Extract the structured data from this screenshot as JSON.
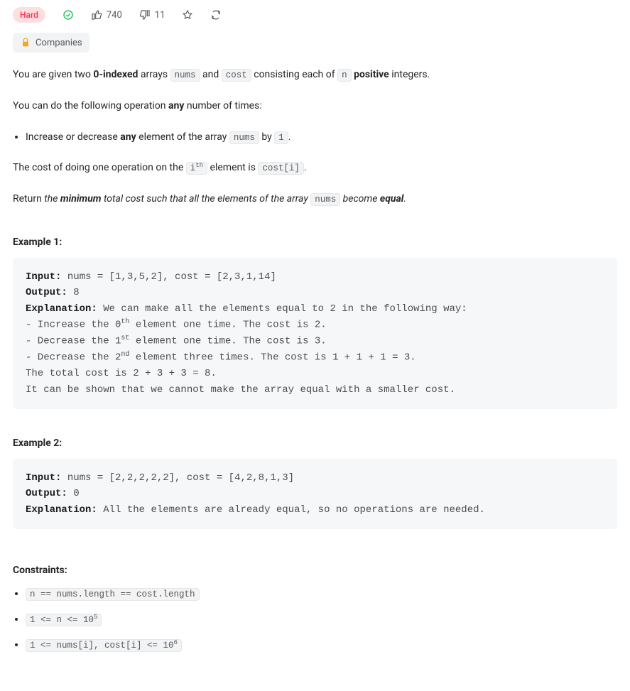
{
  "meta": {
    "difficulty": "Hard",
    "likes": "740",
    "dislikes": "11",
    "companies_label": "Companies"
  },
  "description": {
    "p1_a": "You are given two ",
    "p1_b": "0-indexed",
    "p1_c": " arrays ",
    "p1_code1": "nums",
    "p1_d": " and ",
    "p1_code2": "cost",
    "p1_e": " consisting each of ",
    "p1_code3": "n",
    "p1_f": " ",
    "p1_g": "positive",
    "p1_h": " integers.",
    "p2_a": "You can do the following operation ",
    "p2_b": "any",
    "p2_c": " number of times:",
    "li1_a": "Increase or decrease ",
    "li1_b": "any",
    "li1_c": " element of the array ",
    "li1_code1": "nums",
    "li1_d": " by ",
    "li1_code2": "1",
    "li1_e": ".",
    "p3_a": "The cost of doing one operation on the ",
    "p3_code1_base": "i",
    "p3_code1_sup": "th",
    "p3_b": " element is ",
    "p3_code2": "cost[i]",
    "p3_c": ".",
    "p4_a": "Return ",
    "p4_em1": "the ",
    "p4_strong1": "minimum",
    "p4_em2": " total cost such that all the elements of the array ",
    "p4_code1": "nums",
    "p4_em3": " become ",
    "p4_strong2": "equal",
    "p4_em4": "."
  },
  "examples": {
    "h1": "Example 1:",
    "ex1": {
      "k_in": "Input:",
      "in": " nums = [1,3,5,2], cost = [2,3,1,14]",
      "k_out": "Output:",
      "out": " 8",
      "k_exp": "Explanation:",
      "l1": " We can make all the elements equal to 2 in the following way:",
      "l2a": "- Increase the 0",
      "l2sup": "th",
      "l2b": " element one time. The cost is 2.",
      "l3a": "- Decrease the 1",
      "l3sup": "st",
      "l3b": " element one time. The cost is 3.",
      "l4a": "- Decrease the 2",
      "l4sup": "nd",
      "l4b": " element three times. The cost is 1 + 1 + 1 = 3.",
      "l5": "The total cost is 2 + 3 + 3 = 8.",
      "l6": "It can be shown that we cannot make the array equal with a smaller cost."
    },
    "h2": "Example 2:",
    "ex2": {
      "k_in": "Input:",
      "in": " nums = [2,2,2,2,2], cost = [4,2,8,1,3]",
      "k_out": "Output:",
      "out": " 0",
      "k_exp": "Explanation:",
      "l1": " All the elements are already equal, so no operations are needed."
    }
  },
  "constraints": {
    "heading": "Constraints:",
    "c1": "n == nums.length == cost.length",
    "c2_a": "1 <= n <= 10",
    "c2_sup": "5",
    "c3_a": "1 <= nums[i], cost[i] <= 10",
    "c3_sup": "6"
  }
}
